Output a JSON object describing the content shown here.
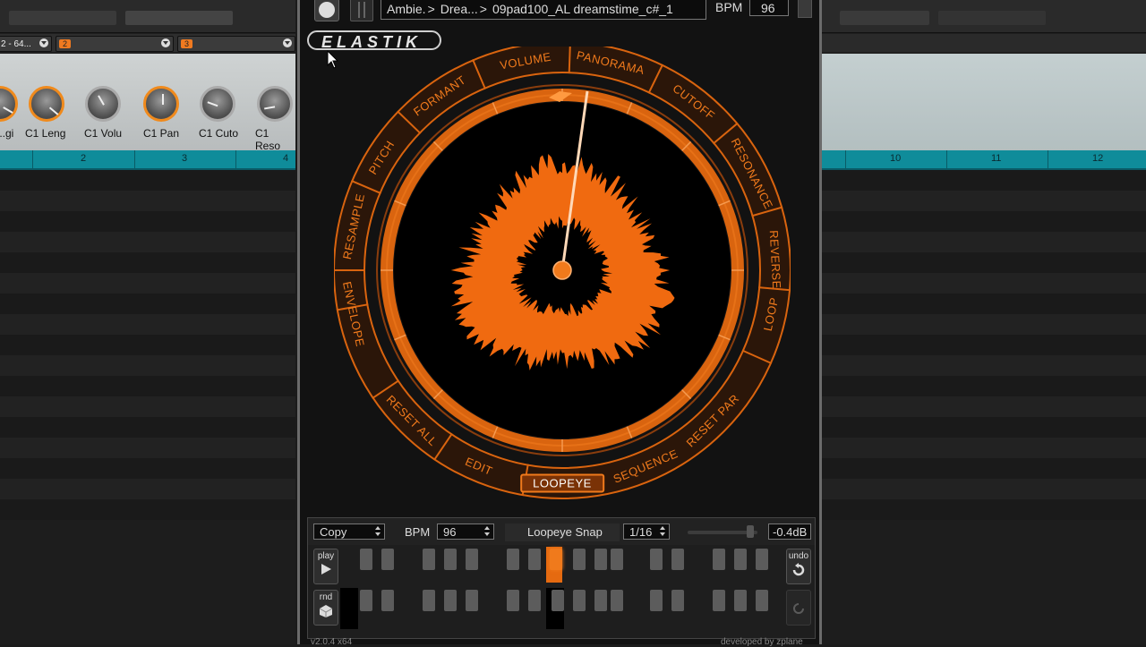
{
  "host": {
    "channels": [
      {
        "label": "2 - 64...",
        "num": ""
      },
      {
        "label": "",
        "num": "2"
      },
      {
        "label": "",
        "num": "3"
      }
    ],
    "knobs": [
      {
        "label": "...gi"
      },
      {
        "label": "C1 Leng"
      },
      {
        "label": "C1 Volu"
      },
      {
        "label": "C1 Pan"
      },
      {
        "label": "C1 Cuto"
      },
      {
        "label": "C1 Reso"
      }
    ],
    "ruler_left": [
      "2",
      "3",
      "4"
    ],
    "ruler_right": [
      "10",
      "11",
      "12"
    ]
  },
  "plugin": {
    "path": {
      "crumb1": "Ambie.",
      "crumb2": "Drea...",
      "file": "09pad100_AL dreamstime_c#_1"
    },
    "bpm_label": "BPM",
    "bpm_value": "96",
    "logo": "ELASTIK",
    "ring_labels": {
      "volume": "VOLUME",
      "panorama": "PANORAMA",
      "formant": "FORMANT",
      "cutoff": "CUTOFF",
      "pitch": "PITCH",
      "resonance": "RESONANCE",
      "resample": "RESAMPLE",
      "reverse": "REVERSE",
      "envelope": "ENVELOPE",
      "loop": "LOOP",
      "reset_all": "RESET ALL",
      "reset_par": "RESET PAR",
      "edit": "EDIT",
      "loopeye": "LOOPEYE",
      "sequence": "SEQUENCE"
    },
    "accent_color": "#f07a1c",
    "sequencer": {
      "mode": "Copy",
      "bpm_label": "BPM",
      "bpm_value": "96",
      "snap_label": "Loopeye Snap",
      "snap_value": "1/16",
      "gain": "-0.4dB",
      "play_label": "play",
      "rnd_label": "rnd",
      "undo_label": "undo"
    },
    "footer_version": "v2.0.4 x64",
    "footer_developer": "developed by zplane"
  }
}
